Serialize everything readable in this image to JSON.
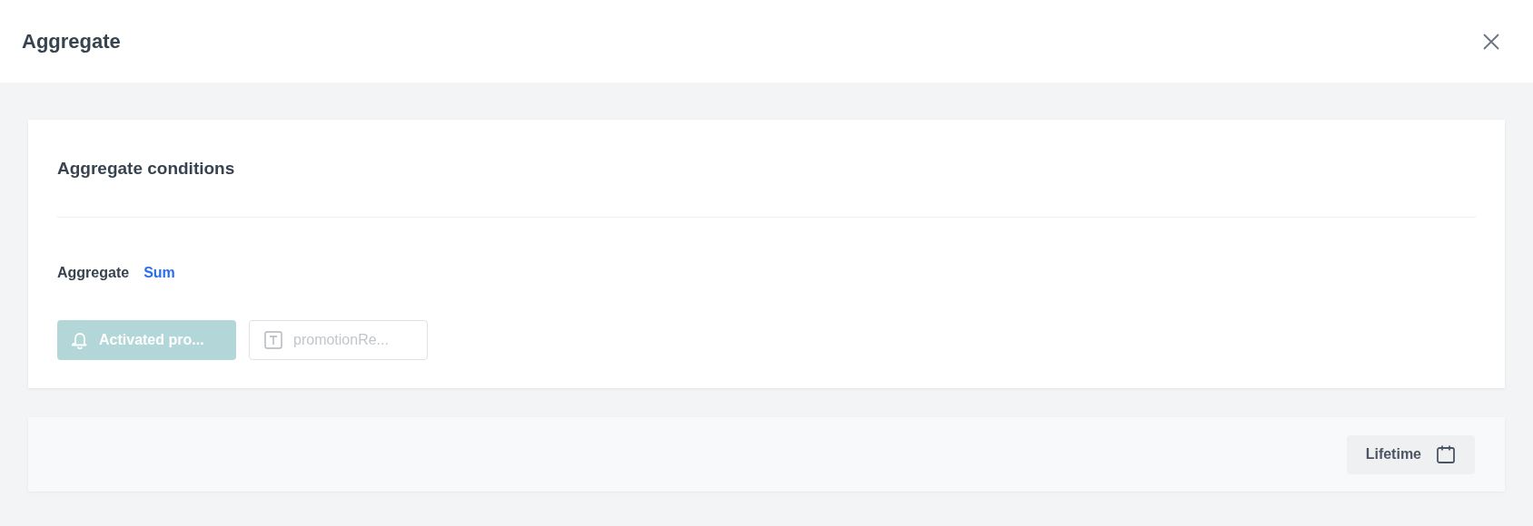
{
  "header": {
    "title": "Aggregate"
  },
  "conditions": {
    "title": "Aggregate conditions",
    "aggregate_label": "Aggregate",
    "aggregate_value": "Sum",
    "chips": [
      {
        "kind": "event",
        "label": "Activated pro...",
        "disabled": true
      },
      {
        "kind": "parameter",
        "label": "promotionRe...",
        "disabled": true
      }
    ]
  },
  "footer": {
    "period": "Lifetime"
  }
}
